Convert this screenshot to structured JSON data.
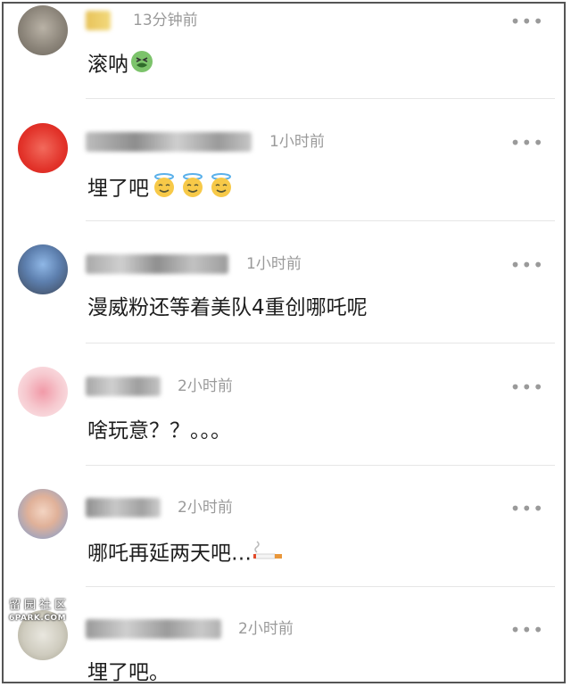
{
  "comments": [
    {
      "time": "13分钟前",
      "text": "滚呐",
      "emojis": [
        "nauseated-face"
      ]
    },
    {
      "time": "1小时前",
      "text": "埋了吧",
      "emojis": [
        "smiling-face-with-halo",
        "smiling-face-with-halo",
        "smiling-face-with-halo"
      ]
    },
    {
      "time": "1小时前",
      "text": "漫威粉还等着美队4重创哪吒呢",
      "emojis": []
    },
    {
      "time": "2小时前",
      "text": "啥玩意？？。。。",
      "emojis": []
    },
    {
      "time": "2小时前",
      "text": "哪吒再延两天吧…",
      "emojis": [
        "cigarette"
      ]
    },
    {
      "time": "2小时前",
      "text": "埋了吧。",
      "emojis": []
    }
  ],
  "more_glyph": "•••",
  "watermark": {
    "logo": "留园社区",
    "site": "6PARK.COM"
  }
}
